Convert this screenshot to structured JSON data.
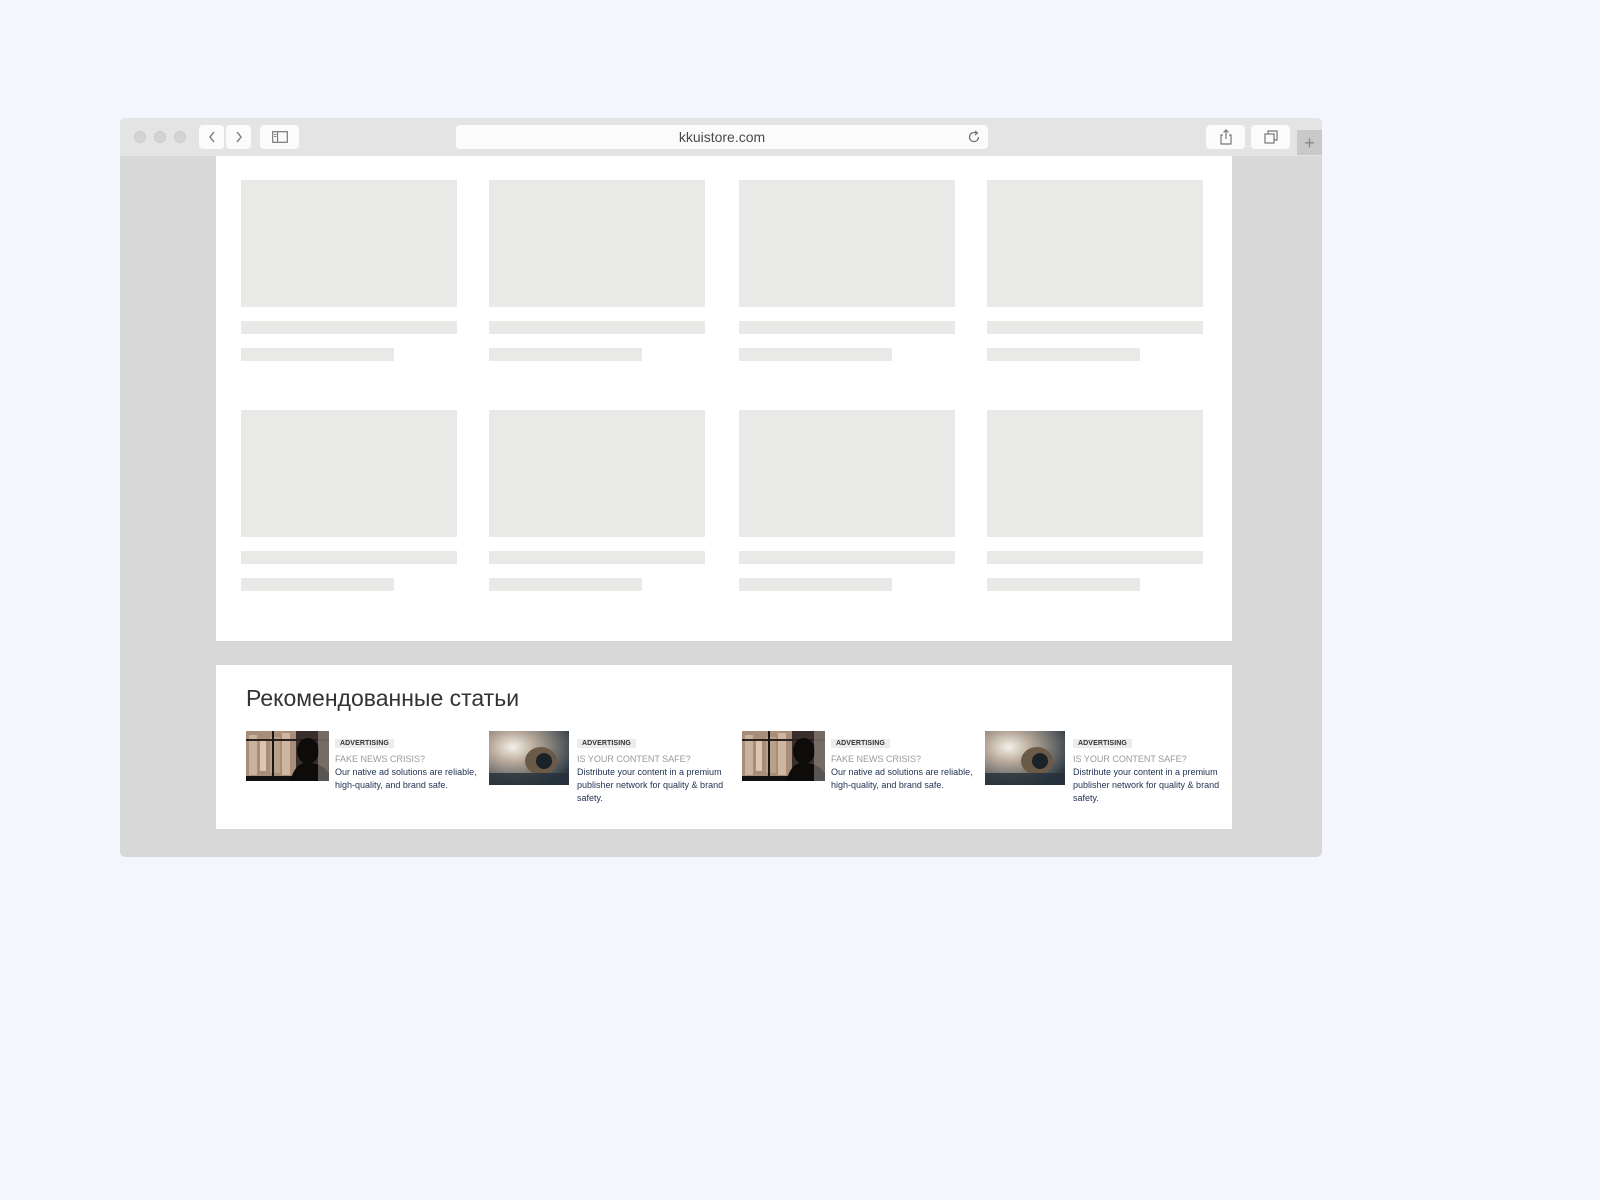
{
  "browser": {
    "url": "kkuistore.com",
    "icons": {
      "back": "chevron-left-icon",
      "forward": "chevron-right-icon",
      "sidebar": "sidebar-icon",
      "reload": "reload-icon",
      "share": "share-icon",
      "tabs": "tabs-icon",
      "new_tab": "plus-icon"
    }
  },
  "colors": {
    "page_bg": "#f3f7fd",
    "window_bg": "#d8d8d8",
    "placeholder": "#e9e9e7",
    "desc_text": "#1e3150"
  },
  "recommended": {
    "title": "Рекомендованные статьи",
    "items": [
      {
        "badge": "ADVERTISING",
        "headline": "FAKE NEWS CRISIS?",
        "description": "Our native ad solutions are reliable, high-quality, and brand safe.",
        "image": "silhouette-image"
      },
      {
        "badge": "ADVERTISING",
        "headline": "IS YOUR CONTENT SAFE?",
        "description": "Distribute your content in a premium publisher network for quality & brand safety.",
        "image": "camera-image"
      },
      {
        "badge": "ADVERTISING",
        "headline": "FAKE NEWS CRISIS?",
        "description": "Our native ad solutions are reliable, high-quality, and brand safe.",
        "image": "silhouette-image"
      },
      {
        "badge": "ADVERTISING",
        "headline": "IS YOUR CONTENT SAFE?",
        "description": "Distribute your content in a premium publisher network for quality & brand safety.",
        "image": "camera-image"
      }
    ]
  }
}
